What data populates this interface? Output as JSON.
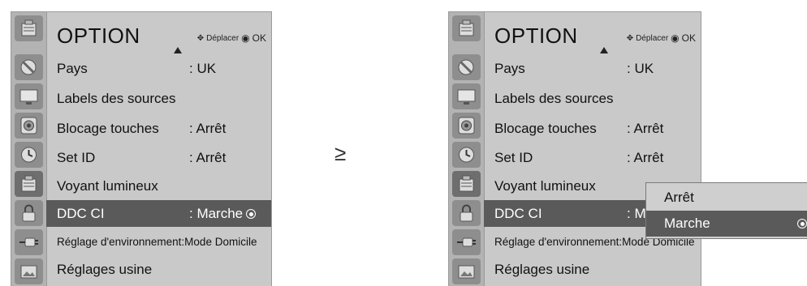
{
  "arrow": "≥",
  "menu": {
    "title": "OPTION",
    "hint_move": "Déplacer",
    "hint_ok": "OK",
    "items": [
      {
        "label": "Pays",
        "value": ": UK"
      },
      {
        "label": "Labels des sources",
        "value": ""
      },
      {
        "label": "Blocage touches",
        "value": ": Arrêt"
      },
      {
        "label": "Set ID",
        "value": ": Arrêt"
      },
      {
        "label": "Voyant lumineux",
        "value": ""
      },
      {
        "label": "DDC CI",
        "value": ": Marche"
      },
      {
        "label": "Réglage d'environnement:Mode Domicile",
        "value": ""
      },
      {
        "label": "Réglages usine",
        "value": ""
      }
    ],
    "right_ddc_value_partial": ": M",
    "right_env_label_partial": "Réglage d'environnement:Mode Domicile"
  },
  "dropdown": {
    "options": [
      "Arrêt",
      "Marche"
    ],
    "selected": "Marche"
  },
  "icons": [
    "satellite-icon",
    "monitor-icon",
    "speaker-icon",
    "clock-icon",
    "option-box-icon",
    "lock-icon",
    "input-plug-icon",
    "photo-usb-icon"
  ],
  "colors": {
    "panel": "#c9c9c9",
    "icon_column": "#b3b3b3",
    "selected_row": "#5a5a5a"
  }
}
